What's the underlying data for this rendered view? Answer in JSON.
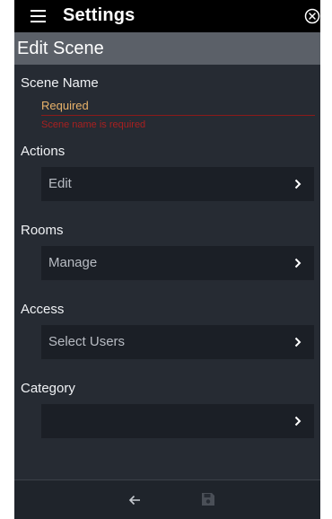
{
  "app_title": "Settings",
  "page_title": "Edit Scene",
  "form": {
    "scene_name_label": "Scene Name",
    "scene_name_placeholder": "Required",
    "scene_name_error": "Scene name is required",
    "actions_label": "Actions",
    "actions_row": "Edit",
    "rooms_label": "Rooms",
    "rooms_row": "Manage",
    "access_label": "Access",
    "access_row": "Select Users",
    "category_label": "Category",
    "category_row": ""
  },
  "icons": {
    "menu": "hamburger-icon",
    "close": "close-circle-icon",
    "chevron": "chevron-right-icon",
    "back": "arrow-left-icon",
    "save": "floppy-disk-icon"
  },
  "colors": {
    "placeholder": "#e8b26a",
    "error": "#a82020"
  }
}
